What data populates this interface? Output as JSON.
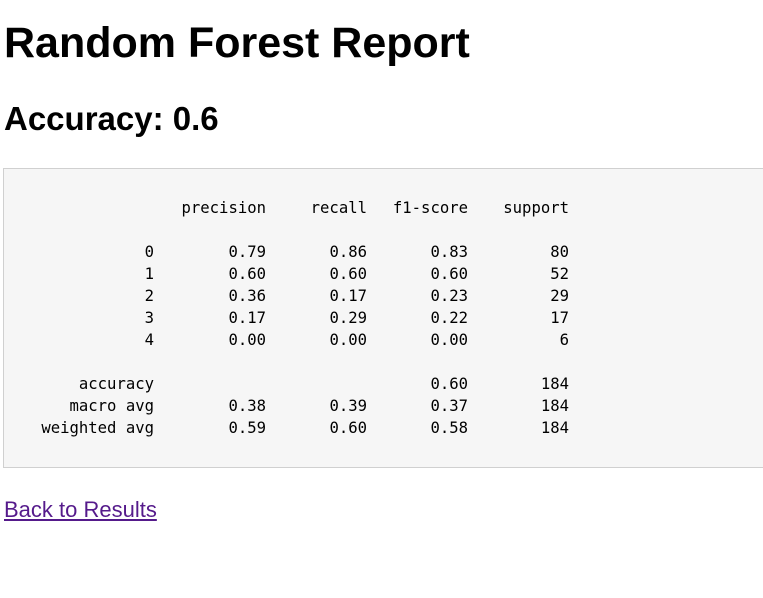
{
  "page": {
    "title": "Random Forest Report",
    "accuracy_heading": "Accuracy: 0.6"
  },
  "report": {
    "headers": [
      "precision",
      "recall",
      "f1-score",
      "support"
    ],
    "rows": [
      {
        "label": "0",
        "precision": "0.79",
        "recall": "0.86",
        "f1": "0.83",
        "support": "80"
      },
      {
        "label": "1",
        "precision": "0.60",
        "recall": "0.60",
        "f1": "0.60",
        "support": "52"
      },
      {
        "label": "2",
        "precision": "0.36",
        "recall": "0.17",
        "f1": "0.23",
        "support": "29"
      },
      {
        "label": "3",
        "precision": "0.17",
        "recall": "0.29",
        "f1": "0.22",
        "support": "17"
      },
      {
        "label": "4",
        "precision": "0.00",
        "recall": "0.00",
        "f1": "0.00",
        "support": "6"
      }
    ],
    "summary": [
      {
        "label": "accuracy",
        "precision": "",
        "recall": "",
        "f1": "0.60",
        "support": "184"
      },
      {
        "label": "macro avg",
        "precision": "0.38",
        "recall": "0.39",
        "f1": "0.37",
        "support": "184"
      },
      {
        "label": "weighted avg",
        "precision": "0.59",
        "recall": "0.60",
        "f1": "0.58",
        "support": "184"
      }
    ]
  },
  "links": {
    "back_label": "Back to Results"
  },
  "colors": {
    "link_visited": "#551a8b",
    "report_background": "#f6f6f6",
    "report_border": "#d0d0d0"
  }
}
